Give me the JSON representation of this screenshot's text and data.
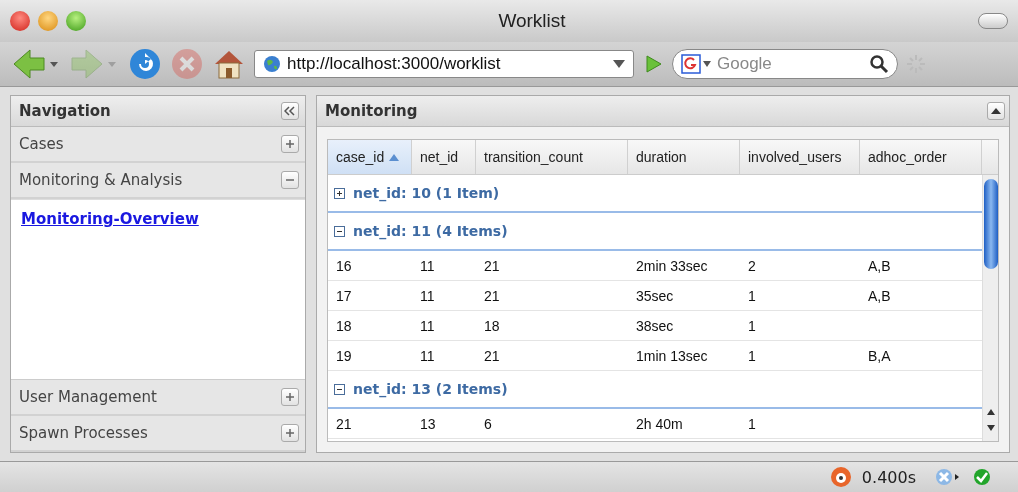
{
  "window": {
    "title": "Worklist"
  },
  "toolbar": {
    "back_disabled": false,
    "forward_disabled": true,
    "stop_disabled": true,
    "url": "http://localhost:3000/worklist",
    "search": {
      "placeholder": "Google"
    }
  },
  "navigation": {
    "title": "Navigation",
    "sections": [
      {
        "label": "Cases",
        "expanded": false
      },
      {
        "label": "Monitoring & Analysis",
        "expanded": true,
        "items": [
          {
            "label": "Monitoring-Overview"
          }
        ]
      },
      {
        "label": "User Management",
        "expanded": false
      },
      {
        "label": "Spawn Processes",
        "expanded": false
      }
    ]
  },
  "panel": {
    "title": "Monitoring",
    "table": {
      "columns": [
        {
          "label": "case_id",
          "sorted": true
        },
        {
          "label": "net_id",
          "sorted": false
        },
        {
          "label": "transition_count",
          "sorted": false
        },
        {
          "label": "duration",
          "sorted": false
        },
        {
          "label": "involved_users",
          "sorted": false
        },
        {
          "label": "adhoc_order",
          "sorted": false
        }
      ],
      "groups": [
        {
          "label": "net_id: 10 (1 Item)",
          "expanded": false
        },
        {
          "label": "net_id: 11 (4 Items)",
          "expanded": true,
          "rows": [
            [
              "16",
              "11",
              "21",
              "2min 33sec",
              "2",
              "A,B"
            ],
            [
              "17",
              "11",
              "21",
              "35sec",
              "1",
              "A,B"
            ],
            [
              "18",
              "11",
              "18",
              "38sec",
              "1",
              ""
            ],
            [
              "19",
              "11",
              "21",
              "1min 13sec",
              "1",
              "B,A"
            ]
          ]
        },
        {
          "label": "net_id: 13 (2 Items)",
          "expanded": true,
          "rows": [
            [
              "21",
              "13",
              "6",
              "2h 40m",
              "1",
              ""
            ]
          ]
        }
      ]
    }
  },
  "status_bar": {
    "time": "0.400s"
  }
}
